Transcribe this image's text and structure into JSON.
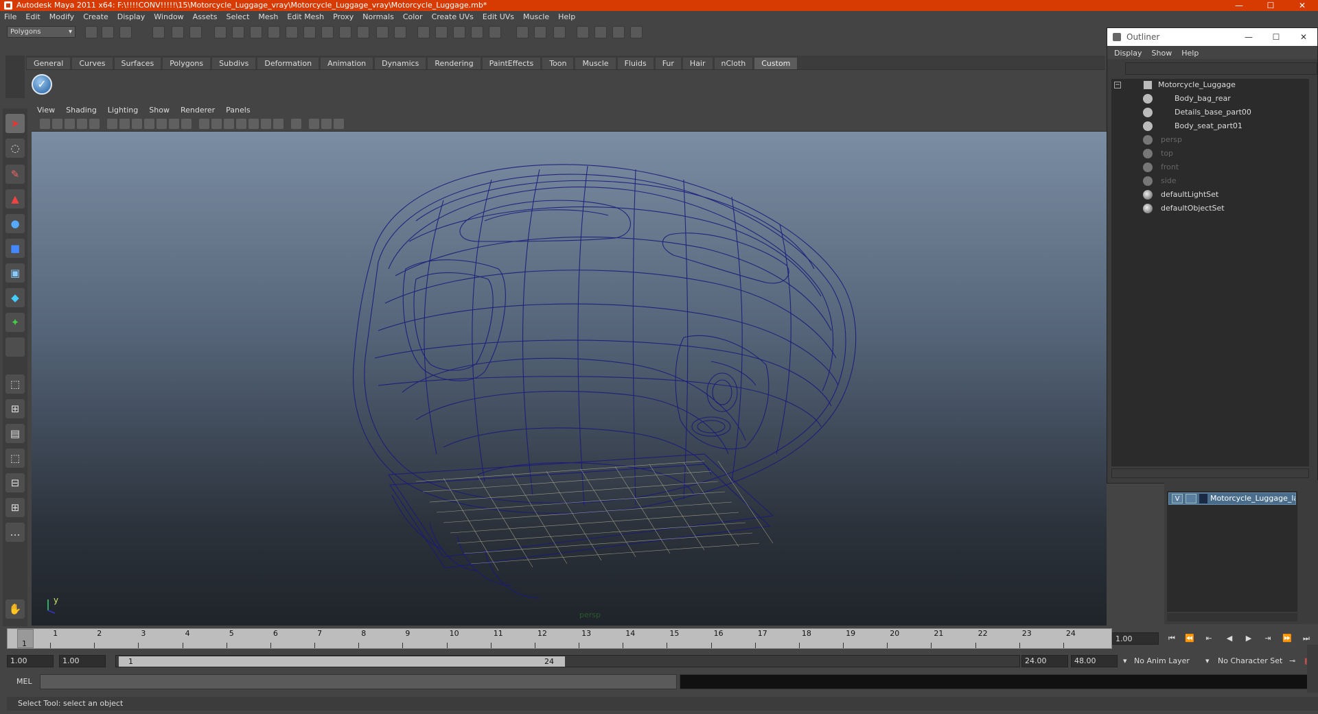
{
  "window": {
    "title": "Autodesk Maya 2011 x64: F:\\!!!!CONV!!!!!\\15\\Motorcycle_Luggage_vray\\Motorcycle_Luggage_vray\\Motorcycle_Luggage.mb*",
    "accent_color": "#d83b01"
  },
  "menubar": [
    "File",
    "Edit",
    "Modify",
    "Create",
    "Display",
    "Window",
    "Assets",
    "Select",
    "Mesh",
    "Edit Mesh",
    "Proxy",
    "Normals",
    "Color",
    "Create UVs",
    "Edit UVs",
    "Muscle",
    "Help"
  ],
  "statusline": {
    "mode": "Polygons"
  },
  "shelf": {
    "tabs": [
      "General",
      "Curves",
      "Surfaces",
      "Polygons",
      "Subdivs",
      "Deformation",
      "Animation",
      "Dynamics",
      "Rendering",
      "PaintEffects",
      "Toon",
      "Muscle",
      "Fluids",
      "Fur",
      "Hair",
      "nCloth",
      "Custom"
    ],
    "active_tab": "Custom",
    "icon": "checkmark-icon"
  },
  "panel": {
    "menu": [
      "View",
      "Shading",
      "Lighting",
      "Show",
      "Renderer",
      "Panels"
    ],
    "camera": "persp",
    "axis_y": "y",
    "wire_color": "#1a1a7a"
  },
  "timeslider": {
    "ticks": [
      "1",
      "2",
      "3",
      "4",
      "5",
      "6",
      "7",
      "8",
      "9",
      "10",
      "11",
      "12",
      "13",
      "14",
      "15",
      "16",
      "17",
      "18",
      "19",
      "20",
      "21",
      "22",
      "23",
      "24"
    ],
    "current": "1",
    "current_field": "1.00"
  },
  "range": {
    "start": "1.00",
    "playback_start": "1.00",
    "handle_start": "1",
    "handle_end": "24",
    "playback_end": "24.00",
    "end": "48.00",
    "anim_layer": "No Anim Layer",
    "char_set": "No Character Set"
  },
  "cmd": {
    "label": "MEL"
  },
  "helpline": "Select Tool: select an object",
  "outliner": {
    "title": "Outliner",
    "menu": [
      "Display",
      "Show",
      "Help"
    ],
    "items": [
      {
        "label": "Motorcycle_Luggage",
        "dim": false
      },
      {
        "label": "Body_bag_rear",
        "dim": false
      },
      {
        "label": "Details_base_part00",
        "dim": false
      },
      {
        "label": "Body_seat_part01",
        "dim": false
      },
      {
        "label": "persp",
        "dim": true
      },
      {
        "label": "top",
        "dim": true
      },
      {
        "label": "front",
        "dim": true
      },
      {
        "label": "side",
        "dim": true
      },
      {
        "label": "defaultLightSet",
        "dim": false
      },
      {
        "label": "defaultObjectSet",
        "dim": false
      }
    ]
  },
  "layers": {
    "visible_flag": "V",
    "name": "Motorcycle_Luggage_layer"
  }
}
